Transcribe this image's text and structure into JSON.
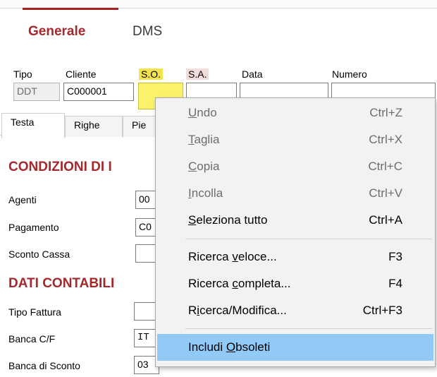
{
  "tabs": {
    "generale": "Generale",
    "dms": "DMS"
  },
  "header": {
    "labels": {
      "tipo": "Tipo",
      "cliente": "Cliente",
      "so": "S.O.",
      "sa": "S.A.",
      "data": "Data",
      "numero": "Numero"
    },
    "values": {
      "tipo": "DDT",
      "cliente": "C000001",
      "so": "",
      "sa": "",
      "data": "",
      "numero": ""
    }
  },
  "subtabs": {
    "testa": "Testa",
    "righe": "Righe",
    "pie": "Pie"
  },
  "sections": {
    "condizioni": "CONDIZIONI DI I",
    "dati": "DATI CONTABILI"
  },
  "rows": {
    "agenti": {
      "label": "Agenti",
      "value": "00"
    },
    "pagamento": {
      "label": "Pagamento",
      "value": "C0"
    },
    "sconto_cassa": {
      "label": "Sconto Cassa",
      "value": ""
    },
    "tipo_fattura": {
      "label": "Tipo Fattura",
      "value": ""
    },
    "banca_cf": {
      "label": "Banca C/F",
      "value": "IT"
    },
    "banca_sconto": {
      "label": "Banca di Sconto",
      "value": "03"
    }
  },
  "context_menu": {
    "items": [
      {
        "label": "Undo",
        "mnemonic": "U",
        "rest": "ndo",
        "shortcut": "Ctrl+Z",
        "enabled": false
      },
      {
        "label": "Taglia",
        "mnemonic": "T",
        "rest": "aglia",
        "shortcut": "Ctrl+X",
        "enabled": false
      },
      {
        "label": "Copia",
        "mnemonic": "C",
        "rest": "opia",
        "shortcut": "Ctrl+C",
        "enabled": false
      },
      {
        "label": "Incolla",
        "mnemonic": "I",
        "rest": "ncolla",
        "shortcut": "Ctrl+V",
        "enabled": false
      },
      {
        "label": "Seleziona tutto",
        "mnemonic": "S",
        "rest": "eleziona tutto",
        "shortcut": "Ctrl+A",
        "enabled": true
      },
      {
        "label": "Ricerca veloce...",
        "pre": "Ricerca ",
        "mnemonic": "v",
        "rest": "eloce...",
        "shortcut": "F3",
        "enabled": true
      },
      {
        "label": "Ricerca completa...",
        "pre": "Ricerca ",
        "mnemonic": "c",
        "rest": "ompleta...",
        "shortcut": "F4",
        "enabled": true
      },
      {
        "label": "Ricerca/Modifica...",
        "pre": "R",
        "mnemonic": "i",
        "rest": "cerca/Modifica...",
        "shortcut": "Ctrl+F3",
        "enabled": true
      },
      {
        "label": "Includi Obsoleti",
        "pre": "Includi ",
        "mnemonic": "O",
        "rest": "bsoleti",
        "shortcut": "",
        "enabled": true,
        "highlighted": true
      }
    ]
  },
  "colors": {
    "accent": "#a3292c",
    "highlight": "#91c9f7",
    "yellow_field": "#fbf26c"
  }
}
